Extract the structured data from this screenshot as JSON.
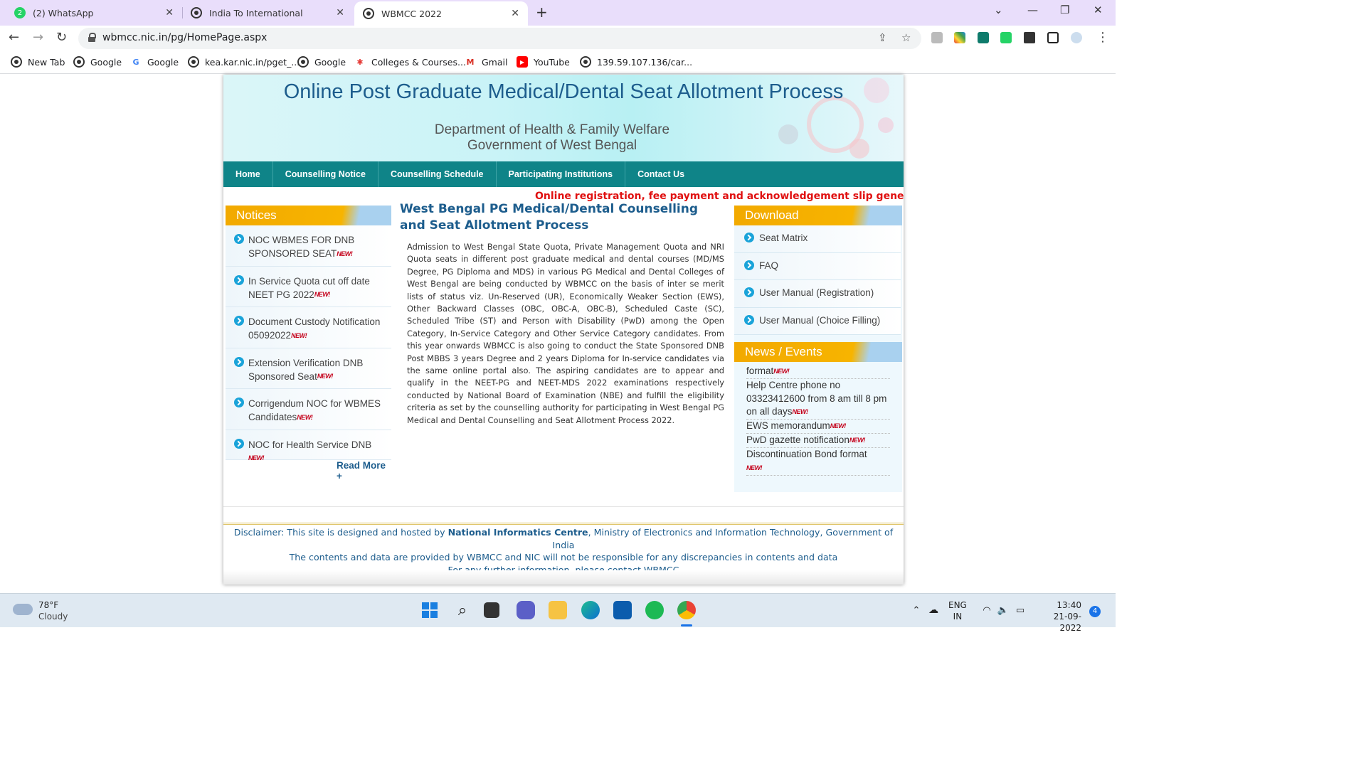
{
  "browser": {
    "tabs": [
      {
        "title": "(2) WhatsApp",
        "badge": "2"
      },
      {
        "title": "India To International"
      },
      {
        "title": "WBMCC 2022"
      }
    ],
    "url": "wbmcc.nic.in/pg/HomePage.aspx",
    "bookmarks": [
      "New Tab",
      "Google",
      "Google",
      "kea.kar.nic.in/pget_...",
      "Google",
      "Colleges & Courses...",
      "Gmail",
      "YouTube",
      "139.59.107.136/car..."
    ]
  },
  "banner": {
    "title": "Online Post Graduate Medical/Dental Seat Allotment Process",
    "line2": "Department of Health & Family Welfare",
    "line3": "Government of West Bengal"
  },
  "nav": [
    "Home",
    "Counselling Notice",
    "Counselling Schedule",
    "Participating Institutions",
    "Contact Us"
  ],
  "marquee": "Online registration, fee payment and acknowledgement slip generati",
  "notices": {
    "heading": "Notices",
    "new_tag": "NEW!",
    "items": [
      "NOC WBMES FOR DNB SPONSORED SEAT",
      "In Service Quota cut off date NEET PG 2022",
      "Document Custody Notification 05092022",
      "Extension Verification DNB Sponsored Seat",
      "Corrigendum NOC for WBMES Candidates",
      "NOC for Health Service DNB"
    ],
    "read_more": "Read More +"
  },
  "main": {
    "heading": "West Bengal PG Medical/Dental Counselling and Seat Allotment Process",
    "body": "Admission to West Bengal State Quota, Private Management Quota and NRI Quota seats in different post graduate medical and dental courses (MD/MS Degree, PG Diploma and MDS) in various PG Medical and Dental Colleges of West Bengal are being conducted by WBMCC on the basis of inter se merit lists of status viz. Un-Reserved (UR), Economically Weaker Section (EWS), Other Backward Classes (OBC, OBC-A, OBC-B), Scheduled Caste (SC), Scheduled Tribe (ST) and Person with Disability (PwD) among the Open Category, In-Service Category and Other Service Category candidates. From this year onwards WBMCC is also going to conduct the State Sponsored DNB Post MBBS 3 years Degree and 2 years Diploma for In-service candidates via the same online portal also. The aspiring candidates are to appear and qualify in the NEET-PG and NEET-MDS 2022 examinations respectively conducted by National Board of Examination (NBE) and fulfill the eligibility criteria as set by the counselling authority for participating in West Bengal PG Medical and Dental Counselling and Seat Allotment Process 2022."
  },
  "download": {
    "heading": "Download",
    "items": [
      "Seat Matrix",
      "FAQ",
      "User Manual (Registration)",
      "User Manual (Choice Filling)"
    ]
  },
  "news": {
    "heading": "News / Events",
    "items": [
      "format",
      " Help Centre phone no 03323412600 from 8 am till 8 pm on all days",
      " EWS memorandum",
      " PwD gazette notification",
      " Discontinuation Bond format"
    ]
  },
  "footer": {
    "line1_prefix": "Disclaimer: This site is designed and hosted by ",
    "line1_bold": "National Informatics Centre",
    "line1_suffix": ", Ministry of Electronics and Information Technology, Government of India",
    "line2": "The contents and data are provided by WBMCC and NIC will not be responsible for any discrepancies in contents and data",
    "line3": "For any further information, please contact WBMCC"
  },
  "taskbar": {
    "temperature": "78°F",
    "condition": "Cloudy",
    "lang1": "ENG",
    "lang2": "IN",
    "time": "13:40",
    "date": "21-09-2022",
    "notif_count": "4"
  }
}
